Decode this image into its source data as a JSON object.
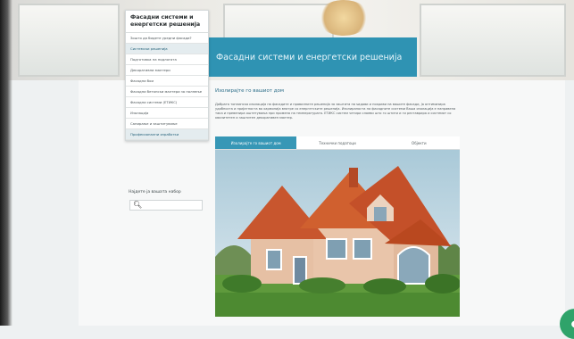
{
  "banner": {
    "title": "Фасадни системи и енергетски решенија"
  },
  "sidebar": {
    "heading": "Фасадни системи и енергетски решенија",
    "items": [
      {
        "label": "Зошто да бидете уредни фасади?"
      },
      {
        "label": "Системски решенија"
      },
      {
        "label": "Подготовка на подлогата"
      },
      {
        "label": "Декоративни малтери"
      },
      {
        "label": "Фасадни бои"
      },
      {
        "label": "Фасадни бетонски малтери за полнење"
      },
      {
        "label": "Фасадни системи (ЕТИКС)"
      },
      {
        "label": "Изолација"
      },
      {
        "label": "Санирање и заштитување"
      },
      {
        "label": "Професионални изработки"
      }
    ]
  },
  "search": {
    "label": "Најдете ја вашата набор",
    "placeholder": ""
  },
  "article": {
    "title": "Изолирајте го вашиот дом",
    "text": "Добрата топлинска изолација на фасадите и правилните решенија за заштита на ѕидови и покриви на вашите фасади, ја оптимизира удобноста и пријатноста во хармонија внатре со енергетските решенија. Изолираноста на фасадните системи Ваша изолација е направена така и превенира оштетувања при промена на температурата. ЕТИКС систем четири слоеви што го штити и ги реставрира и системот со квалитетен и заштитен декоративен малтер."
  },
  "tabs": [
    {
      "label": "Изолирајте го вашиот дом"
    },
    {
      "label": "Технички податоци"
    },
    {
      "label": "Објекти"
    }
  ],
  "colors": {
    "accent": "#2f93b3",
    "fab": "#2fa36a"
  },
  "icons": {
    "search": "magnifier-icon",
    "fab": "chat-icon"
  }
}
